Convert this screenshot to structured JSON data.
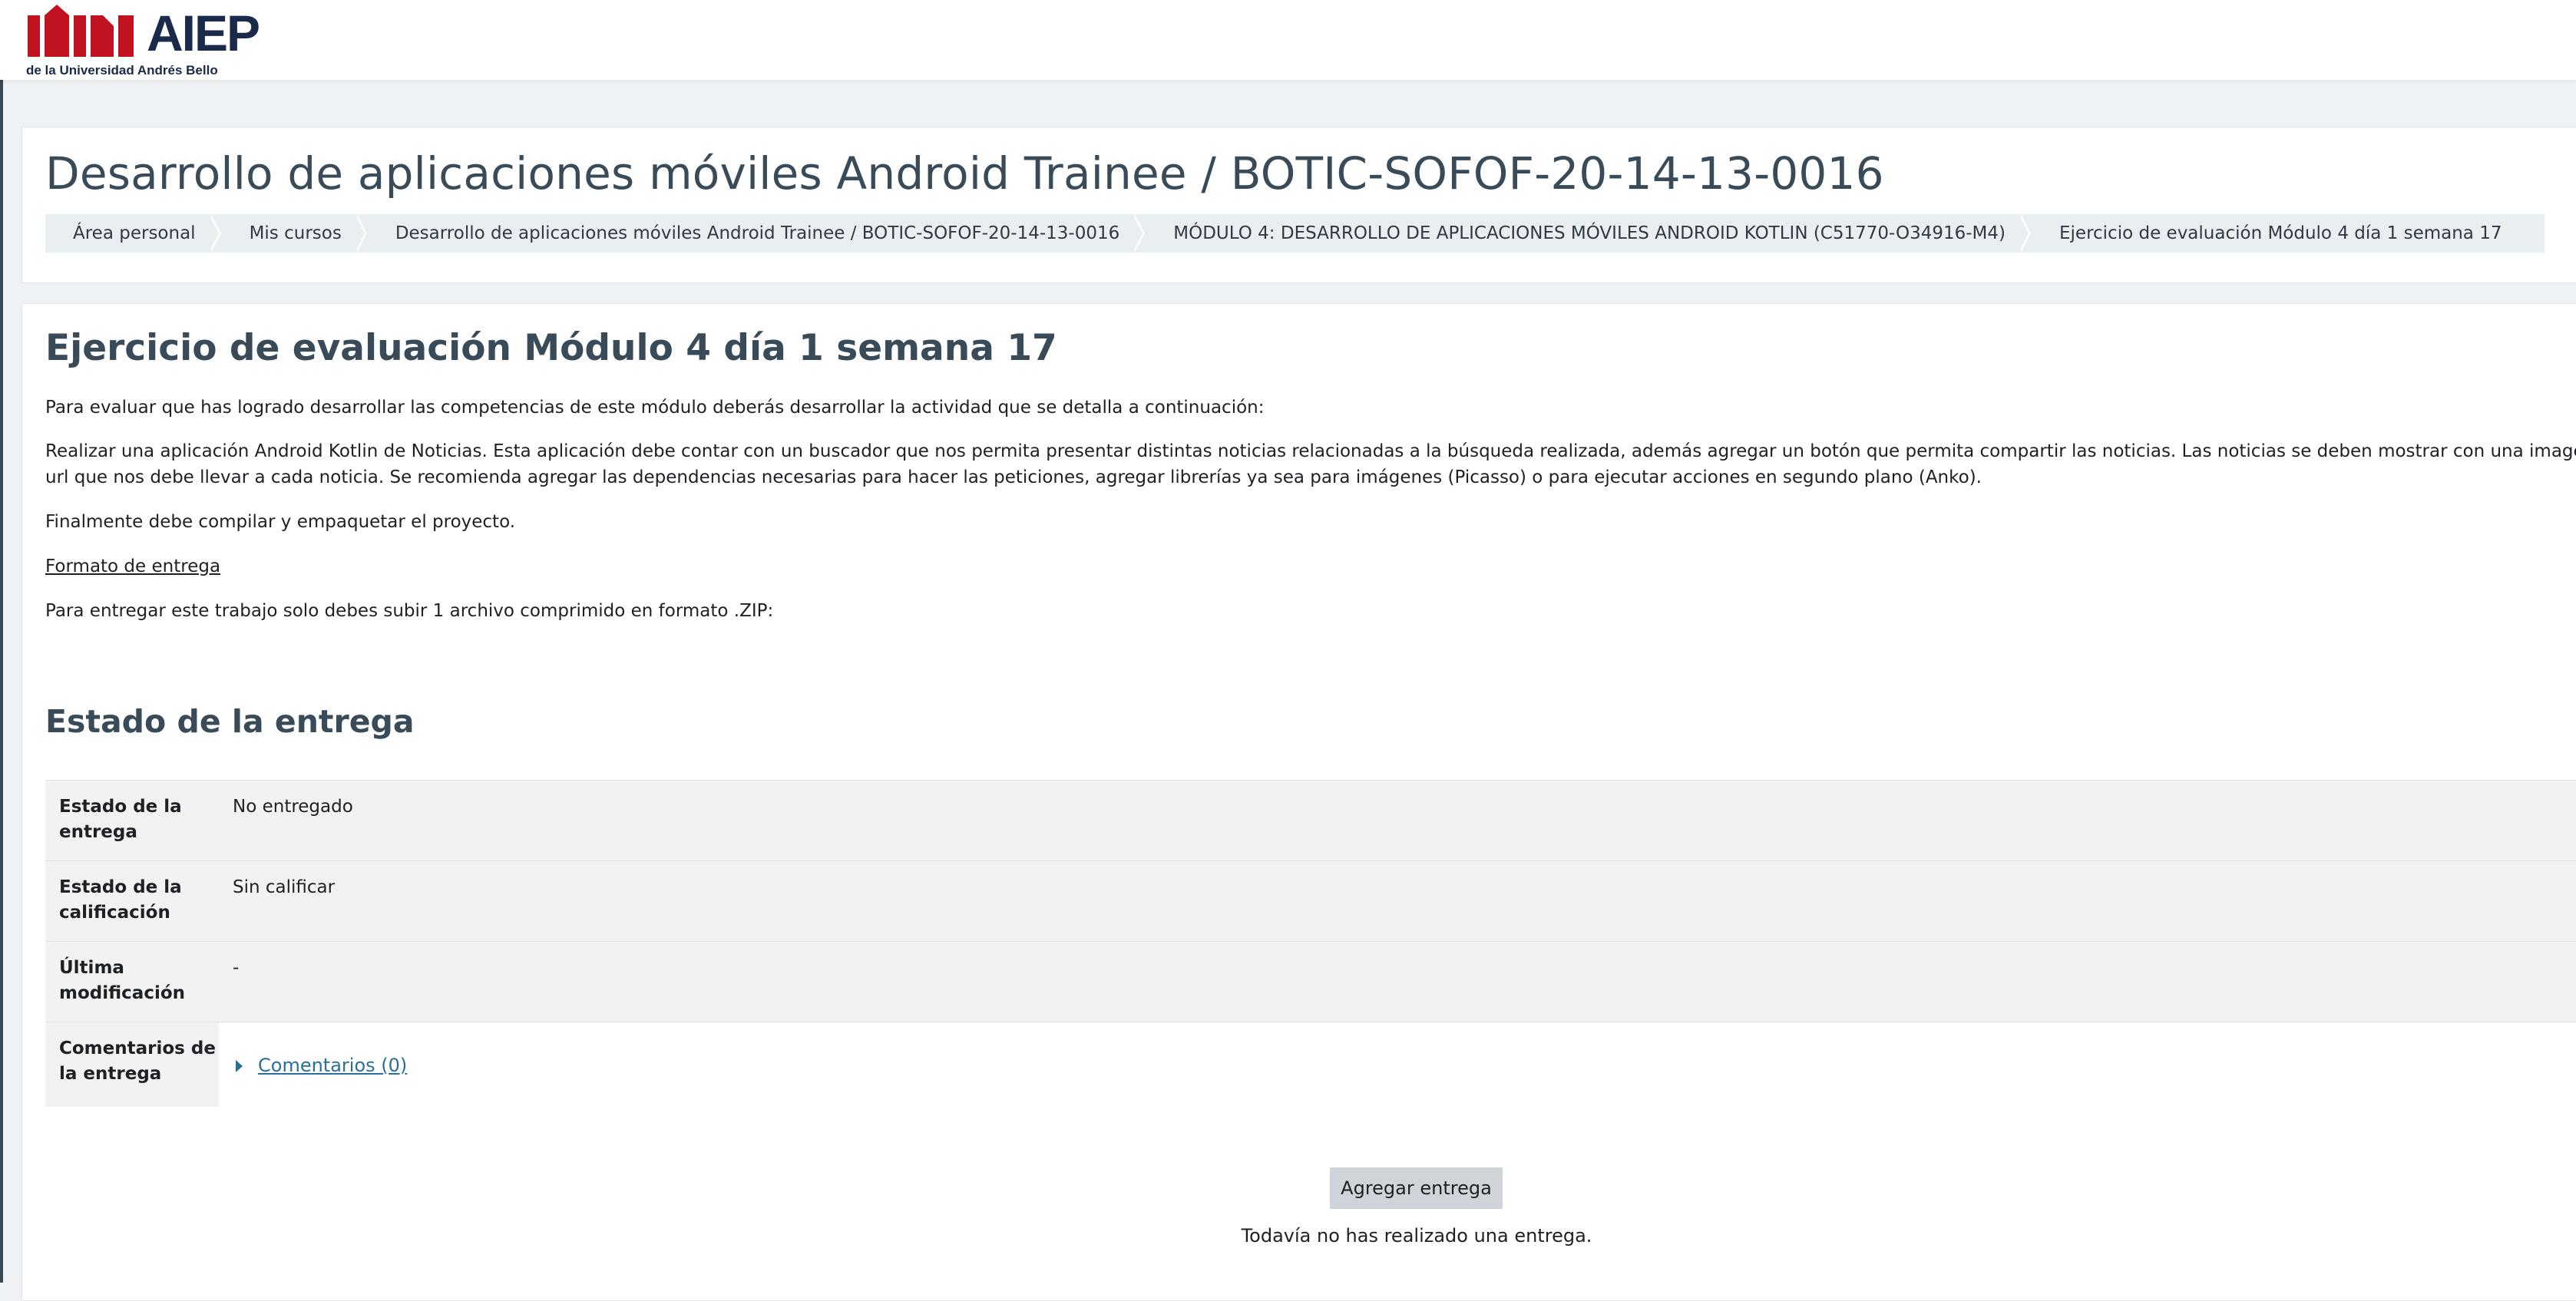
{
  "brand": {
    "logo_text": "AIEP",
    "logo_subtitle": "de la Universidad Andrés Bello",
    "logo_color": "#c1121f"
  },
  "header": {
    "course_title": "Desarrollo de aplicaciones móviles Android Trainee / BOTIC-SOFOF-20-14-13-0016",
    "breadcrumb": [
      "Área personal",
      "Mis cursos",
      "Desarrollo de aplicaciones móviles Android Trainee / BOTIC-SOFOF-20-14-13-0016",
      "MÓDULO 4: DESARROLLO DE APLICACIONES MÓVILES ANDROID KOTLIN (C51770-O34916-M4)",
      "Ejercicio de evaluación Módulo 4 día 1 semana 17"
    ]
  },
  "activity": {
    "title": "Ejercicio de evaluación Módulo 4 día 1 semana 17",
    "intro": "Para evaluar que has logrado desarrollar las competencias de este módulo deberás desarrollar la actividad que se detalla a continuación:",
    "description_line1": "Realizar una aplicación Android Kotlin de Noticias. Esta aplicación debe contar con un buscador que nos permita presentar distintas noticias relacionadas a la búsqueda realizada, además agregar un botón que permita compartir las noticias. Las noticias se deben mostrar con una imagen que",
    "description_line2": "url que nos debe llevar a cada noticia. Se recomienda agregar las dependencias necesarias para hacer las peticiones, agregar librerías ya sea para imágenes (Picasso) o para ejecutar acciones en segundo plano (Anko).",
    "final_note": "Finalmente debe compilar y empaquetar el proyecto.",
    "format_heading": "Formato de entrega",
    "format_text": "Para entregar este trabajo solo debes subir 1 archivo comprimido en formato .ZIP:"
  },
  "submission_status": {
    "title": "Estado de la entrega",
    "rows": [
      {
        "label": "Estado de la entrega",
        "value": "No entregado"
      },
      {
        "label": "Estado de la calificación",
        "value": "Sin calificar"
      },
      {
        "label": "Última modificación",
        "value": "-"
      },
      {
        "label": "Comentarios de la entrega",
        "value": "Comentarios (0)"
      }
    ],
    "add_button": "Agregar entrega",
    "no_submission_text": "Todavía no has realizado una entrega."
  }
}
